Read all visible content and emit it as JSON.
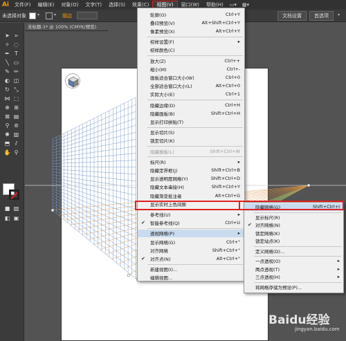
{
  "app": {
    "logo": "Ai"
  },
  "menubar": {
    "items": [
      "文件(F)",
      "编辑(E)",
      "对象(O)",
      "文字(T)",
      "选择(S)",
      "效果(C)",
      "视图(V)",
      "窗口(W)",
      "帮助(H)"
    ],
    "active_index": 6
  },
  "controlbar": {
    "selection_label": "未选择对象",
    "fill_label": "描边",
    "doc_setup": "文档设置",
    "preferences": "首选项"
  },
  "doc_tab": {
    "title": "未标题-1* @ 100% (CMYK/预览)"
  },
  "view_menu": {
    "items": [
      {
        "label": "轮廓(O)",
        "shortcut": "Ctrl+Y"
      },
      {
        "label": "叠印预览(V)",
        "shortcut": "Alt+Shift+Ctrl+Y"
      },
      {
        "label": "像素预览(X)",
        "shortcut": "Alt+Ctrl+Y"
      },
      {
        "label": "校样设置(F)",
        "shortcut": "",
        "submenu": true
      },
      {
        "label": "校样颜色(C)",
        "shortcut": ""
      },
      {
        "label": "放大(Z)",
        "shortcut": "Ctrl++"
      },
      {
        "label": "缩小(M)",
        "shortcut": "Ctrl+-"
      },
      {
        "label": "画板适合窗口大小(W)",
        "shortcut": "Ctrl+0"
      },
      {
        "label": "全部适合窗口大小(L)",
        "shortcut": "Alt+Ctrl+0"
      },
      {
        "label": "实际大小(E)",
        "shortcut": "Ctrl+1"
      },
      {
        "label": "隐藏边缘(D)",
        "shortcut": "Ctrl+H"
      },
      {
        "label": "隐藏画板(B)",
        "shortcut": "Shift+Ctrl+H"
      },
      {
        "label": "显示打印拼贴(T)",
        "shortcut": ""
      },
      {
        "label": "显示切片(S)",
        "shortcut": ""
      },
      {
        "label": "锁定切片(K)",
        "shortcut": ""
      },
      {
        "label": "隐藏模板(L)",
        "shortcut": "Shift+Ctrl+W",
        "disabled": true
      },
      {
        "label": "标尺(R)",
        "shortcut": "",
        "submenu": true
      },
      {
        "label": "隐藏定界框(J)",
        "shortcut": "Shift+Ctrl+B"
      },
      {
        "label": "显示透明度网格(Y)",
        "shortcut": "Shift+Ctrl+D"
      },
      {
        "label": "隐藏文本串接(H)",
        "shortcut": "Shift+Ctrl+Y"
      },
      {
        "label": "隐藏渐变批注者",
        "shortcut": "Alt+Ctrl+G"
      },
      {
        "label": "显示实时上色间隙",
        "shortcut": ""
      },
      {
        "label": "参考线(U)",
        "shortcut": "",
        "submenu": true
      },
      {
        "label": "智能参考线(Q)",
        "shortcut": "Ctrl+U",
        "checked": true
      },
      {
        "label": "透视网格(P)",
        "shortcut": "",
        "submenu": true,
        "highlight": true
      },
      {
        "label": "显示网格(G)",
        "shortcut": "Ctrl+\""
      },
      {
        "label": "对齐网格",
        "shortcut": "Shift+Ctrl+\""
      },
      {
        "label": "对齐点(N)",
        "shortcut": "Alt+Ctrl+\"",
        "checked": true
      },
      {
        "label": "新建视图(I)...",
        "shortcut": ""
      },
      {
        "label": "编辑视图...",
        "shortcut": ""
      }
    ]
  },
  "submenu": {
    "items": [
      {
        "label": "隐藏网格(G)",
        "shortcut": "Shift+Ctrl+I",
        "highlight": true
      },
      {
        "label": "显示标尺(R)",
        "shortcut": ""
      },
      {
        "label": "对齐网格(N)",
        "shortcut": "",
        "checked": true
      },
      {
        "label": "锁定网格(K)",
        "shortcut": ""
      },
      {
        "label": "锁定站点(K)",
        "shortcut": ""
      },
      {
        "label": "定义网格(D)...",
        "shortcut": ""
      },
      {
        "label": "一点透视(O)",
        "shortcut": "",
        "submenu": true
      },
      {
        "label": "两点透视(T)",
        "shortcut": "",
        "submenu": true
      },
      {
        "label": "三点透视(H)",
        "shortcut": "",
        "submenu": true
      },
      {
        "label": "将网格存储为预设(P)...",
        "shortcut": ""
      }
    ]
  },
  "watermark": {
    "brand": "Baidu经验",
    "url": "jingyan.baidu.com"
  },
  "colors": {
    "accent_red": "#e02020",
    "highlight": "#c9dbef",
    "grid_blue": "#7a9cc8",
    "grid_green": "#6aa070",
    "grid_orange": "#d89040"
  }
}
